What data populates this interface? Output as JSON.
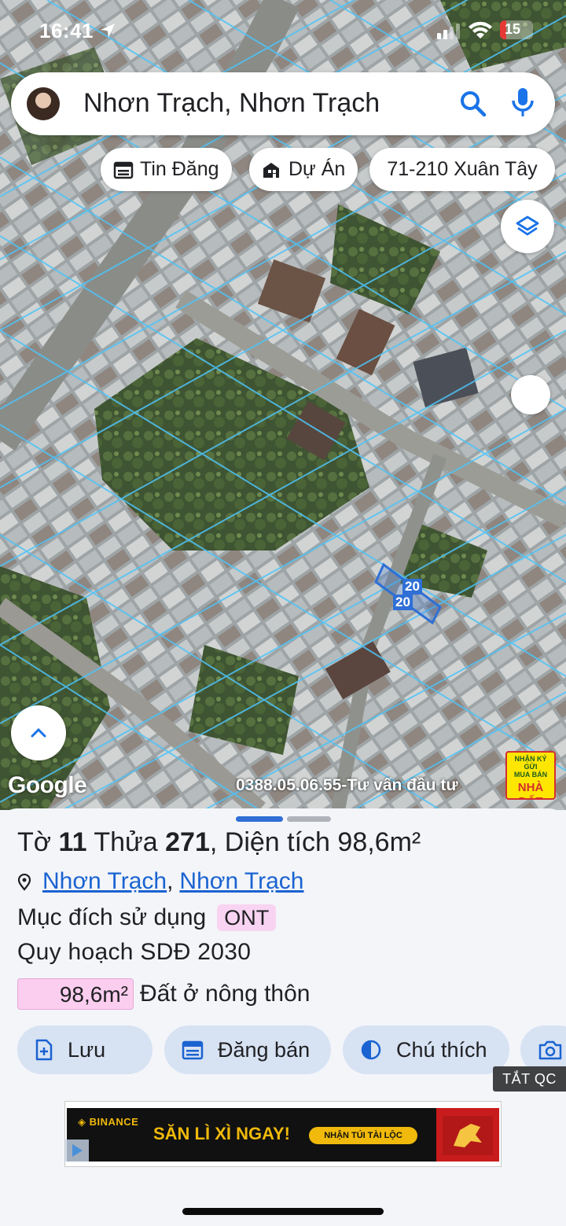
{
  "status_bar": {
    "time": "16:41",
    "battery": "15"
  },
  "search": {
    "query": "Nhơn Trạch, Nhơn Trạch"
  },
  "chips": [
    {
      "label": "Tin Đăng",
      "icon": "listing-calendar-icon"
    },
    {
      "label": "Dự Án",
      "icon": "project-building-icon"
    },
    {
      "label": "71-210 Xuân Tây",
      "icon": ""
    }
  ],
  "map": {
    "parcel_label_a": "20",
    "parcel_label_b": "20",
    "logo": "Google",
    "credit": "0388.05.06.55-Tư vấn đầu tư",
    "promo": {
      "line1": "NHẬN KÝ GỬI",
      "line2": "MUA BÁN",
      "line3": "NHÀ ĐẤT"
    },
    "parcel_color": "#2f6fd6",
    "boundary_color": "#4fc3f7"
  },
  "parcel": {
    "sheet_label": "Tờ",
    "sheet_no": "11",
    "lot_label": "Thửa",
    "lot_no": "271",
    "area_label": ", Diện tích",
    "area": "98,6m²",
    "location": {
      "ward": "Nhơn Trạch",
      "separator": ",",
      "district": "Nhơn Trạch"
    },
    "usage_label": "Mục đích sử dụng",
    "usage_code": "ONT",
    "plan_label": "Quy hoạch SDĐ 2030",
    "zone_area": "98,6m²",
    "zone_label": "Đất ở nông thôn",
    "zone_color": "#fbcdee"
  },
  "actions": [
    {
      "label": "Lưu",
      "icon": "save-doc-icon"
    },
    {
      "label": "Đăng bán",
      "icon": "calendar-post-icon"
    },
    {
      "label": "Chú thích",
      "icon": "legend-contrast-icon"
    },
    {
      "label": "",
      "icon": "camera-add-icon"
    }
  ],
  "ad": {
    "close_label": "TẮT QC",
    "brand": "◈ BINANCE",
    "headline": "SĂN LÌ XÌ NGAY!",
    "cta": "NHẬN TÚI TÀI LỘC"
  },
  "accent_color": "#1a63d1"
}
